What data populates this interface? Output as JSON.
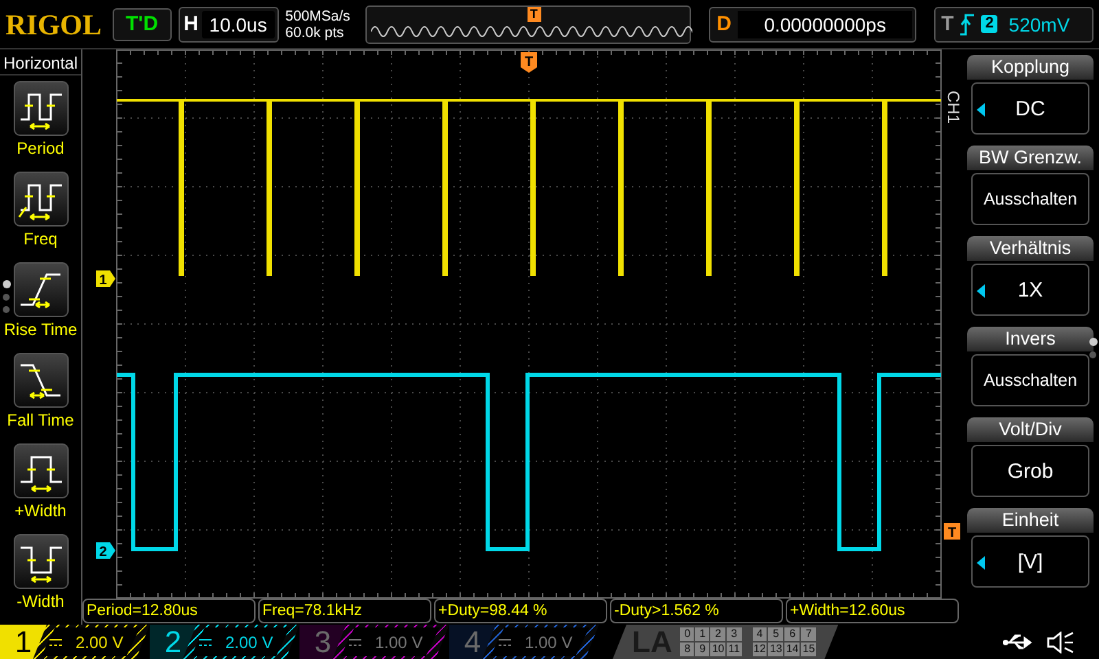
{
  "header": {
    "logo": "RIGOL",
    "run_status": "T'D",
    "timebase": {
      "label": "H",
      "value": "10.0us"
    },
    "sample_rate": "500MSa/s",
    "memory_depth": "60.0k pts",
    "overview_marker": "T",
    "delay": {
      "label": "D",
      "value": "0.00000000ps"
    },
    "trigger": {
      "label": "T",
      "source": "2",
      "level": "520mV"
    }
  },
  "left_menu": {
    "title": "Horizontal",
    "pages": [
      {
        "selected": true
      },
      {
        "selected": false
      },
      {
        "selected": false
      }
    ],
    "items": [
      {
        "kind": "period",
        "label": "Period"
      },
      {
        "kind": "freq",
        "label": "Freq"
      },
      {
        "kind": "rise",
        "label": "Rise Time"
      },
      {
        "kind": "fall",
        "label": "Fall Time"
      },
      {
        "kind": "pwidth",
        "label": "+Width"
      },
      {
        "kind": "nwidth",
        "label": "-Width"
      }
    ]
  },
  "display": {
    "trigger_time_marker": "T",
    "trigger_level_marker": "T",
    "channel_label": "CH1",
    "channel_markers": [
      {
        "label": "1",
        "color": "#f0e000"
      },
      {
        "label": "2",
        "color": "#00d8e8"
      }
    ]
  },
  "right_menu": {
    "pages": [
      {
        "selected": true
      },
      {
        "selected": false
      }
    ],
    "items": [
      {
        "title": "Kopplung",
        "value": "DC",
        "has_options": true
      },
      {
        "title": "BW Grenzw.",
        "value": "Ausschalten",
        "has_options": false
      },
      {
        "title": "Verhältnis",
        "value": "1X",
        "has_options": true
      },
      {
        "title": "Invers",
        "value": "Ausschalten",
        "has_options": false
      },
      {
        "title": "Volt/Div",
        "value": "Grob",
        "has_options": false
      },
      {
        "title": "Einheit",
        "value": "[V]",
        "has_options": true
      }
    ]
  },
  "measurements": [
    "Period=12.80us",
    "Freq=78.1kHz",
    "+Duty=98.44 %",
    "-Duty>1.562 %",
    "+Width=12.60us"
  ],
  "channels": [
    {
      "number": "1",
      "scale": "2.00 V",
      "enabled": true,
      "selected": true,
      "color": "#f0e000"
    },
    {
      "number": "2",
      "scale": "2.00 V",
      "enabled": true,
      "selected": false,
      "color": "#00d8e8"
    },
    {
      "number": "3",
      "scale": "1.00 V",
      "enabled": false,
      "selected": false,
      "color": "#c000c0"
    },
    {
      "number": "4",
      "scale": "1.00 V",
      "enabled": false,
      "selected": false,
      "color": "#2060d0"
    }
  ],
  "logic_analyzer": {
    "label": "LA",
    "bits": [
      "0",
      "1",
      "2",
      "3",
      "4",
      "5",
      "6",
      "7",
      "8",
      "9",
      "10",
      "11",
      "12",
      "13",
      "14",
      "15"
    ]
  }
}
